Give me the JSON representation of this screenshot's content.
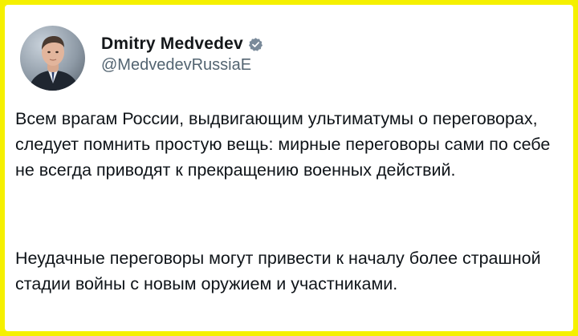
{
  "post": {
    "author": {
      "name": "Dmitry Medvedev",
      "handle": "@MedvedevRussiaE",
      "verified": true,
      "verified_icon": "verified-badge-icon",
      "verified_color": "#7a8a9a"
    },
    "paragraphs": [
      "Всем врагам России, выдвигающим ультиматумы о переговорах, следует помнить простую вещь: мирные переговоры сами по себе не всегда приводят к прекращению военных действий.",
      "Неудачные переговоры могут привести к началу более страшной стадии войны с новым оружием и участниками."
    ]
  },
  "colors": {
    "frame": "#f5f000",
    "card": "#ffffff",
    "text": "#0f1419",
    "secondary_text": "#536471"
  }
}
